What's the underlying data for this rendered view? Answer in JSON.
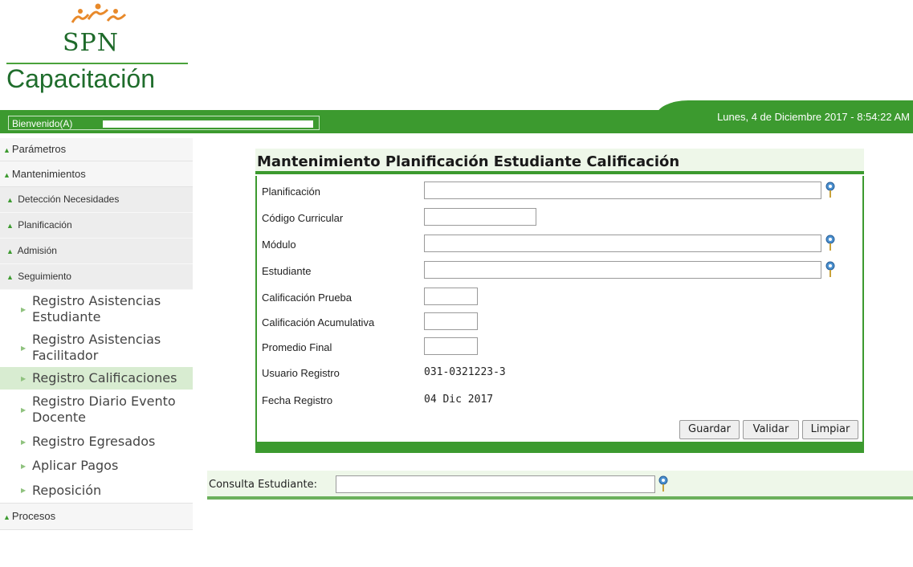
{
  "logo": {
    "brand": "SPN",
    "name": "Capacitación"
  },
  "header": {
    "welcome": "Bienvenido(A)",
    "datetime": "Lunes, 4 de Diciembre 2017 - 8:54:22 AM"
  },
  "sidebar": {
    "parametros": "Parámetros",
    "mantenimientos": "Mantenimientos",
    "subs": [
      "Detección Necesidades",
      "Planificación",
      "Admisión",
      "Seguimiento"
    ],
    "leaves": [
      "Registro Asistencias Estudiante",
      "Registro Asistencias Facilitador",
      "Registro Calificaciones",
      "Registro Diario Evento Docente",
      "Registro Egresados",
      "Aplicar Pagos",
      "Reposición"
    ],
    "procesos": "Procesos"
  },
  "form": {
    "title": "Mantenimiento Planificación Estudiante Calificación",
    "labels": {
      "planificacion": "Planificación",
      "codigo": "Código Curricular",
      "modulo": "Módulo",
      "estudiante": "Estudiante",
      "calif_prueba": "Calificación Prueba",
      "calif_acum": "Calificación Acumulativa",
      "promedio": "Promedio Final",
      "usuario": "Usuario Registro",
      "fecha": "Fecha Registro"
    },
    "values": {
      "planificacion": "",
      "codigo": "",
      "modulo": "",
      "estudiante": "",
      "calif_prueba": "",
      "calif_acum": "",
      "promedio": "",
      "usuario": "031-0321223-3",
      "fecha": "04 Dic 2017"
    },
    "buttons": {
      "guardar": "Guardar",
      "validar": "Validar",
      "limpiar": "Limpiar"
    }
  },
  "consulta": {
    "label": "Consulta Estudiante:",
    "value": ""
  },
  "colors": {
    "brand_green": "#3c9a2f",
    "panel_bg": "#eef7e9",
    "active_item": "#d8ecd1"
  },
  "icons": {
    "lookup": "lookup-pin-icon",
    "bullet": "tree-bullet-icon",
    "leaf": "arrow-right-icon"
  }
}
